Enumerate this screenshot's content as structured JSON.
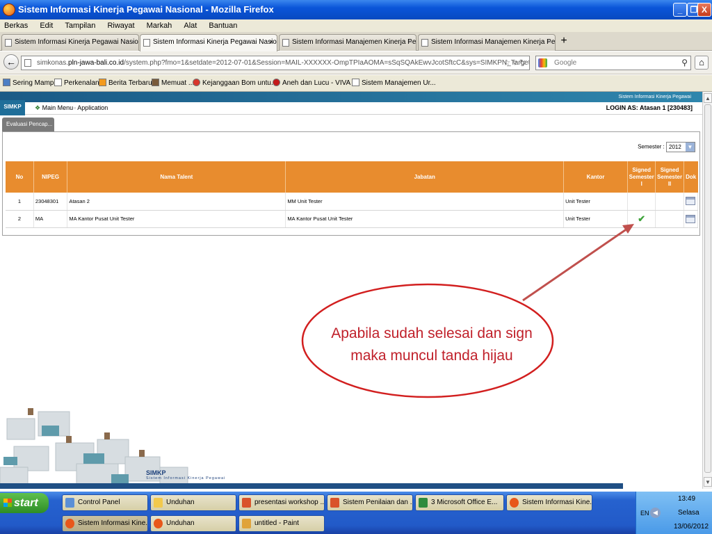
{
  "window": {
    "title": "Sistem Informasi Kinerja Pegawai Nasional - Mozilla Firefox",
    "minimize": "_",
    "maximize": "❐",
    "close": "X"
  },
  "menu": [
    "Berkas",
    "Edit",
    "Tampilan",
    "Riwayat",
    "Markah",
    "Alat",
    "Bantuan"
  ],
  "tabs": [
    {
      "label": "Sistem Informasi Kinerja Pegawai Nasional"
    },
    {
      "label": "Sistem Informasi Kinerja Pegawai Nasional"
    },
    {
      "label": "Sistem Informasi Manajemen Kinerja Peg..."
    },
    {
      "label": "Sistem Informasi Manajemen Kinerja Peg..."
    }
  ],
  "tab_close": "×",
  "new_tab": "+",
  "address": {
    "prefix": "simkonas.",
    "host": "pln-jawa-bali.co.id",
    "path": "/system.php?fmo=1&setdate=2012-07-01&Session=MAIL-XXXXXX-OmpTPIaAOMA=sSqSQAkEwvJcotSftcC&sys=SIMKPN_Target_Mentor"
  },
  "search": {
    "placeholder": "Google"
  },
  "bookmarks": [
    "Sering Mampir",
    "Perkenalan",
    "Berita Terbaru",
    "Memuat ...",
    "Kejanggaan Bom untu...",
    "Aneh dan Lucu - VIVA ...",
    "Sistem Manajemen Ur..."
  ],
  "app": {
    "strip_text": "Sistem Informasi Kinerja Pegawai",
    "logo": "SIMKP",
    "main_menu": "Main Menu",
    "application": "Application",
    "login": "LOGIN AS: Atasan 1 [230483]",
    "tab": "Evaluasi Pencap...",
    "semester_label": "Semester :",
    "semester_value": "2012",
    "footer_logo": "SIMKP",
    "footer_sub": "Sistem Informasi Kinerja Pegawai"
  },
  "table": {
    "headers": [
      "No",
      "NIPEG",
      "Nama Talent",
      "Jabatan",
      "Kantor",
      "Signed Semester I",
      "Signed Semester II",
      "Dok"
    ],
    "rows": [
      {
        "no": "1",
        "nipeg": "23048301",
        "nama": "Atasan 2",
        "jabatan": "MM Unit Tester",
        "kantor": "Unit Tester",
        "signed1": "",
        "signed2": ""
      },
      {
        "no": "2",
        "nipeg": "MA",
        "nama": "MA Kantor Pusat Unit Tester",
        "jabatan": "MA Kantor Pusat Unit Tester",
        "kantor": "Unit Tester",
        "signed1": "✔",
        "signed2": ""
      }
    ]
  },
  "callout": {
    "line1": "Apabila sudah selesai dan sign",
    "line2": "maka muncul tanda hijau",
    "color": "#d21f1f"
  },
  "taskbar": {
    "start": "start",
    "items_row1": [
      "Control Panel",
      "Unduhan",
      "presentasi workshop ...",
      "Sistem Penilaian dan ...",
      "3 Microsoft Office E...",
      "Sistem Informasi Kine..."
    ],
    "items_row2": [
      "Sistem Informasi Kine...",
      "Unduhan",
      "untitled - Paint"
    ],
    "tray": {
      "lang": "EN",
      "time": "13:49",
      "day": "Selasa",
      "date": "13/06/2012"
    }
  },
  "colors": {
    "header_orange": "#e88c2e",
    "title_blue": "#0a55d9",
    "check_green": "#3da33a"
  }
}
